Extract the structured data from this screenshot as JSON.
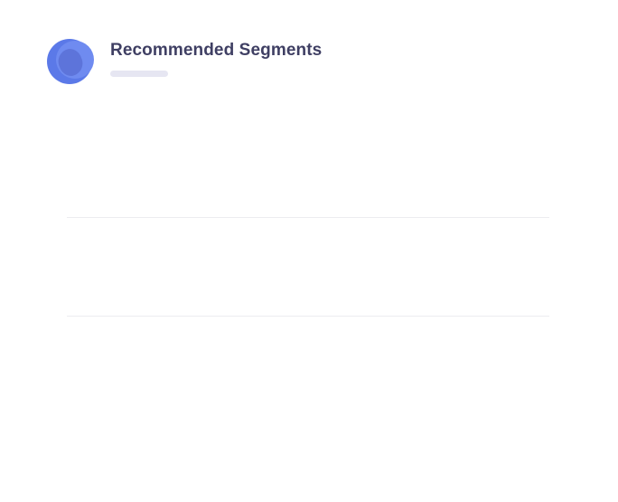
{
  "widget": {
    "title": "Recommended Segments",
    "logo_icon": "overlapping-circles-logo-icon",
    "colors": {
      "logo_primary": "#5b79e8",
      "logo_secondary": "#6f8bf0",
      "logo_overlap": "#4f63c9",
      "title": "#3f3f63",
      "placeholder": "#e6e6f2",
      "divider": "#ececf0"
    }
  },
  "segments": [
    {
      "label": ""
    },
    {
      "label": ""
    },
    {
      "label": ""
    }
  ]
}
